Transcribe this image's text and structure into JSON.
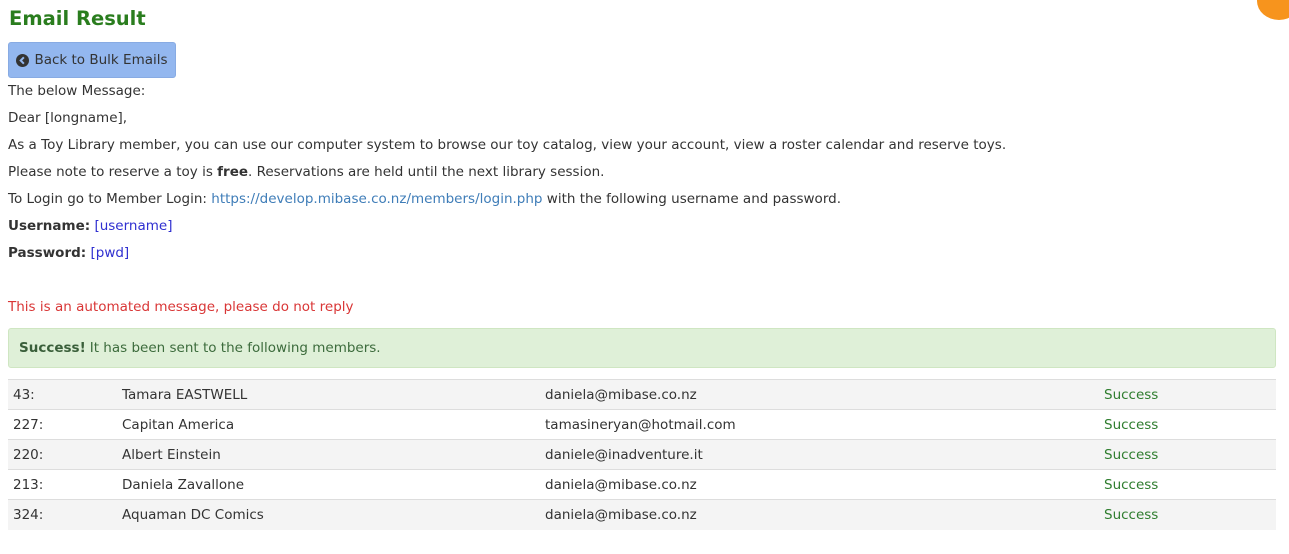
{
  "page": {
    "title": "Email Result",
    "back_button": {
      "label": "Back to Bulk Emails",
      "icon": "arrow-circle-left-icon"
    }
  },
  "message": {
    "intro": "The below Message:",
    "greeting": "Dear [longname],",
    "line1": "As a Toy Library member, you can use our computer system to browse our toy catalog, view your account, view a roster calendar and reserve toys.",
    "line2_prefix": "Please note to reserve a toy is ",
    "line2_bold": "free",
    "line2_suffix": ". Reservations are held until the next library session.",
    "login_prefix": "To Login go to Member Login: ",
    "login_link": "https://develop.mibase.co.nz/members/login.php",
    "login_suffix": " with the following username and password.",
    "username_label": "Username:",
    "username_value": "[username]",
    "password_label": "Password:",
    "password_value": "[pwd]",
    "automated_note": "This is an automated message, please do not reply"
  },
  "alert": {
    "strong": "Success!",
    "text": "It has been sent to the following members."
  },
  "members": [
    {
      "id": "43:",
      "name": "Tamara EASTWELL",
      "email": "daniela@mibase.co.nz",
      "status": "Success"
    },
    {
      "id": "227:",
      "name": "Capitan America",
      "email": "tamasineryan@hotmail.com",
      "status": "Success"
    },
    {
      "id": "220:",
      "name": "Albert Einstein",
      "email": "daniele@inadventure.it",
      "status": "Success"
    },
    {
      "id": "213:",
      "name": "Daniela Zavallone",
      "email": "daniela@mibase.co.nz",
      "status": "Success"
    },
    {
      "id": "324:",
      "name": "Aquaman DC Comics",
      "email": "daniela@mibase.co.nz",
      "status": "Success"
    }
  ],
  "colors": {
    "title": "#2a7d1e",
    "button_bg": "#93b7ef",
    "link": "#3f7db8",
    "placeholder": "#2f2fd0",
    "warning": "#d93636",
    "alert_bg": "#dff0d8",
    "status_success": "#2e7d2e"
  }
}
